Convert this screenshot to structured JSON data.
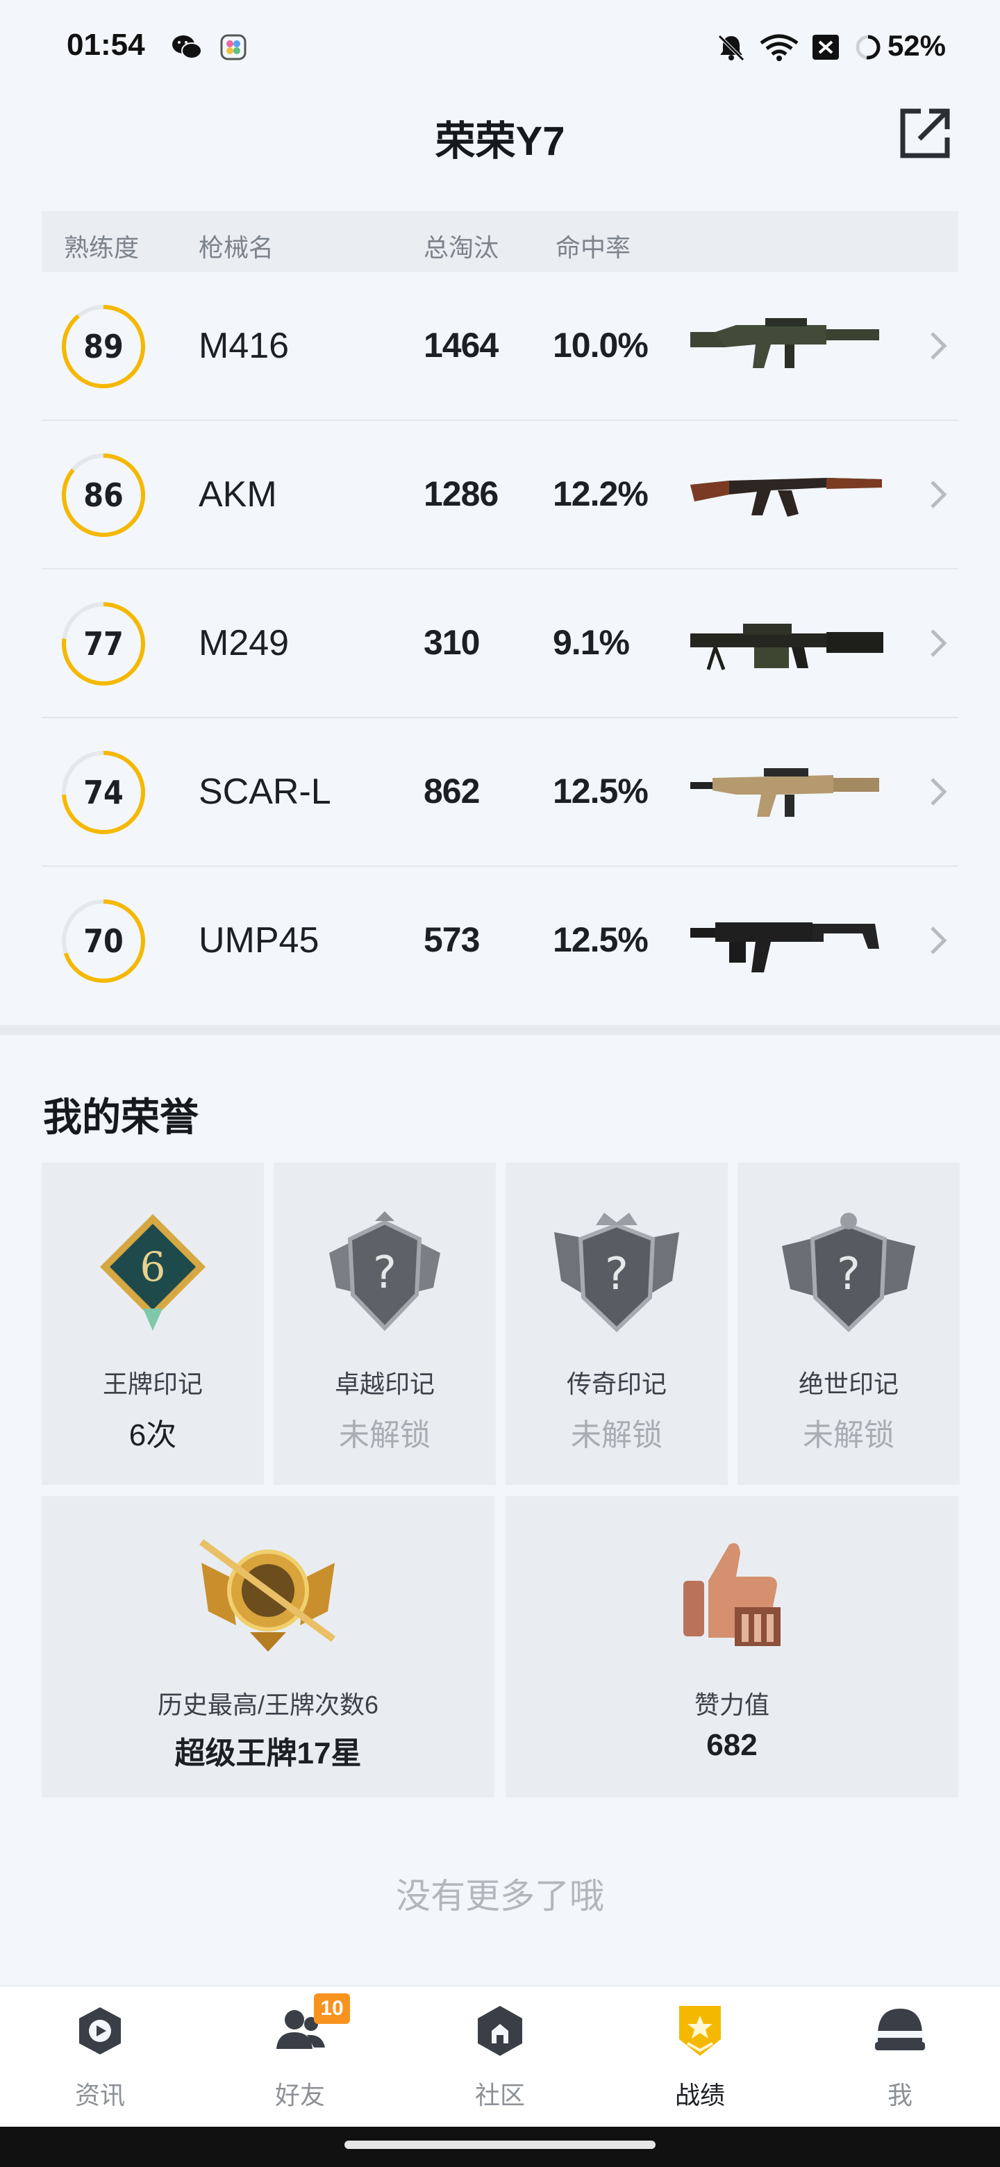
{
  "status_bar": {
    "time": "01:54",
    "battery": "52%",
    "icons": [
      "wechat-icon",
      "app-icon",
      "mute-icon",
      "wifi-icon",
      "sim-off-icon",
      "battery-ring-icon"
    ]
  },
  "header": {
    "title": "荣荣Y7",
    "share_icon": "share-external-icon"
  },
  "weapon_table": {
    "headers": {
      "proficiency": "熟练度",
      "gun_name": "枪械名",
      "eliminations": "总淘汰",
      "accuracy": "命中率"
    },
    "rows": [
      {
        "proficiency": "89",
        "proficiency_fraction": 0.89,
        "name": "M416",
        "eliminations": "1464",
        "accuracy": "10.0%",
        "gun_icon": "m416-rifle-icon"
      },
      {
        "proficiency": "86",
        "proficiency_fraction": 0.86,
        "name": "AKM",
        "eliminations": "1286",
        "accuracy": "12.2%",
        "gun_icon": "akm-rifle-icon"
      },
      {
        "proficiency": "77",
        "proficiency_fraction": 0.77,
        "name": "M249",
        "eliminations": "310",
        "accuracy": "9.1%",
        "gun_icon": "m249-lmg-icon"
      },
      {
        "proficiency": "74",
        "proficiency_fraction": 0.74,
        "name": "SCAR-L",
        "eliminations": "862",
        "accuracy": "12.5%",
        "gun_icon": "scar-l-rifle-icon"
      },
      {
        "proficiency": "70",
        "proficiency_fraction": 0.7,
        "name": "UMP45",
        "eliminations": "573",
        "accuracy": "12.5%",
        "gun_icon": "ump45-smg-icon"
      }
    ]
  },
  "honor": {
    "title": "我的荣誉",
    "badges": [
      {
        "label": "王牌印记",
        "value": "6次",
        "locked": false,
        "icon": "ace-mark-badge-icon"
      },
      {
        "label": "卓越印记",
        "value": "未解锁",
        "locked": true,
        "icon": "locked-badge-icon"
      },
      {
        "label": "传奇印记",
        "value": "未解锁",
        "locked": true,
        "icon": "locked-badge-icon"
      },
      {
        "label": "绝世印记",
        "value": "未解锁",
        "locked": true,
        "icon": "locked-badge-icon"
      }
    ],
    "rank_card": {
      "label": "历史最高/王牌次数6",
      "value": "超级王牌17星",
      "icon": "super-ace-rank-icon"
    },
    "likes_card": {
      "label": "赞力值",
      "value": "682",
      "icon": "thumbs-up-icon"
    }
  },
  "footer_text": "没有更多了哦",
  "bottom_nav": {
    "items": [
      {
        "label": "资讯",
        "icon": "news-icon",
        "active": false
      },
      {
        "label": "好友",
        "icon": "friends-icon",
        "active": false,
        "badge": "10"
      },
      {
        "label": "社区",
        "icon": "community-icon",
        "active": false
      },
      {
        "label": "战绩",
        "icon": "records-icon",
        "active": true
      },
      {
        "label": "我",
        "icon": "profile-helmet-icon",
        "active": false
      }
    ]
  },
  "colors": {
    "accent_orange": "#f5b800",
    "ring_track": "#e4e7eb",
    "background": "#f3f6fa"
  }
}
